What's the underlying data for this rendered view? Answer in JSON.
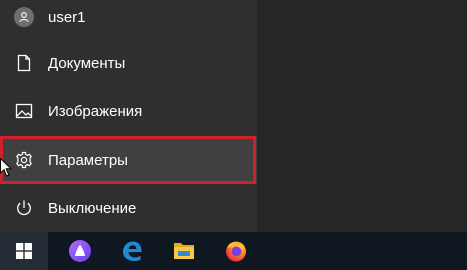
{
  "start_menu": {
    "items": [
      {
        "label": "user1",
        "icon": "user-avatar-icon"
      },
      {
        "label": "Документы",
        "icon": "document-icon"
      },
      {
        "label": "Изображения",
        "icon": "pictures-icon"
      },
      {
        "label": "Параметры",
        "icon": "gear-icon",
        "highlighted": true
      },
      {
        "label": "Выключение",
        "icon": "power-icon"
      }
    ]
  },
  "taskbar": {
    "buttons": [
      {
        "icon": "windows-start-icon"
      },
      {
        "icon": "alice-assistant-icon"
      },
      {
        "icon": "edge-browser-icon"
      },
      {
        "icon": "file-explorer-icon"
      },
      {
        "icon": "firefox-browser-icon"
      }
    ]
  },
  "colors": {
    "menu_background": "#2f2f2f",
    "highlight_background": "#404040",
    "highlight_border": "#d0212b",
    "taskbar_background": "#0f1720",
    "text": "#ffffff"
  }
}
